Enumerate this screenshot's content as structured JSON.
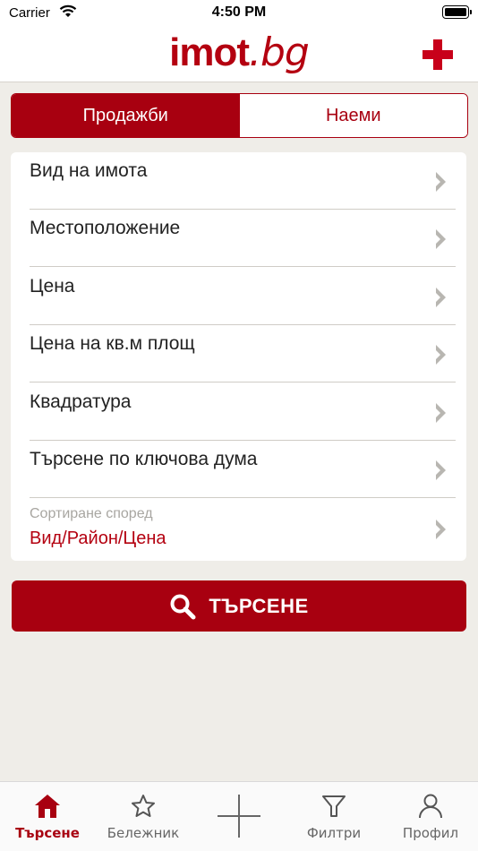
{
  "status_bar": {
    "carrier": "Carrier",
    "time": "4:50 PM"
  },
  "header": {
    "logo_main": "imot",
    "logo_suffix": ".bg",
    "accent_color": "#b40010"
  },
  "segmented": {
    "items": [
      {
        "label": "Продажби",
        "selected": true
      },
      {
        "label": "Наеми",
        "selected": false
      }
    ]
  },
  "filters": {
    "items": [
      {
        "label": "Вид на имота"
      },
      {
        "label": "Местоположение"
      },
      {
        "label": "Цена"
      },
      {
        "label": "Цена на кв.м площ"
      },
      {
        "label": "Квадратура"
      },
      {
        "label": "Търсене по ключова дума"
      }
    ],
    "sort": {
      "label": "Сортиране според",
      "value": "Вид/Район/Цена"
    }
  },
  "search_button": {
    "label": "ТЪРСЕНЕ"
  },
  "tab_bar": {
    "items": [
      {
        "label": "Търсене",
        "icon": "home-icon",
        "active": true
      },
      {
        "label": "Бележник",
        "icon": "star-icon",
        "active": false
      },
      {
        "label": "",
        "icon": "plus-icon",
        "active": false
      },
      {
        "label": "Филтри",
        "icon": "filter-icon",
        "active": false
      },
      {
        "label": "Профил",
        "icon": "profile-icon",
        "active": false
      }
    ]
  }
}
